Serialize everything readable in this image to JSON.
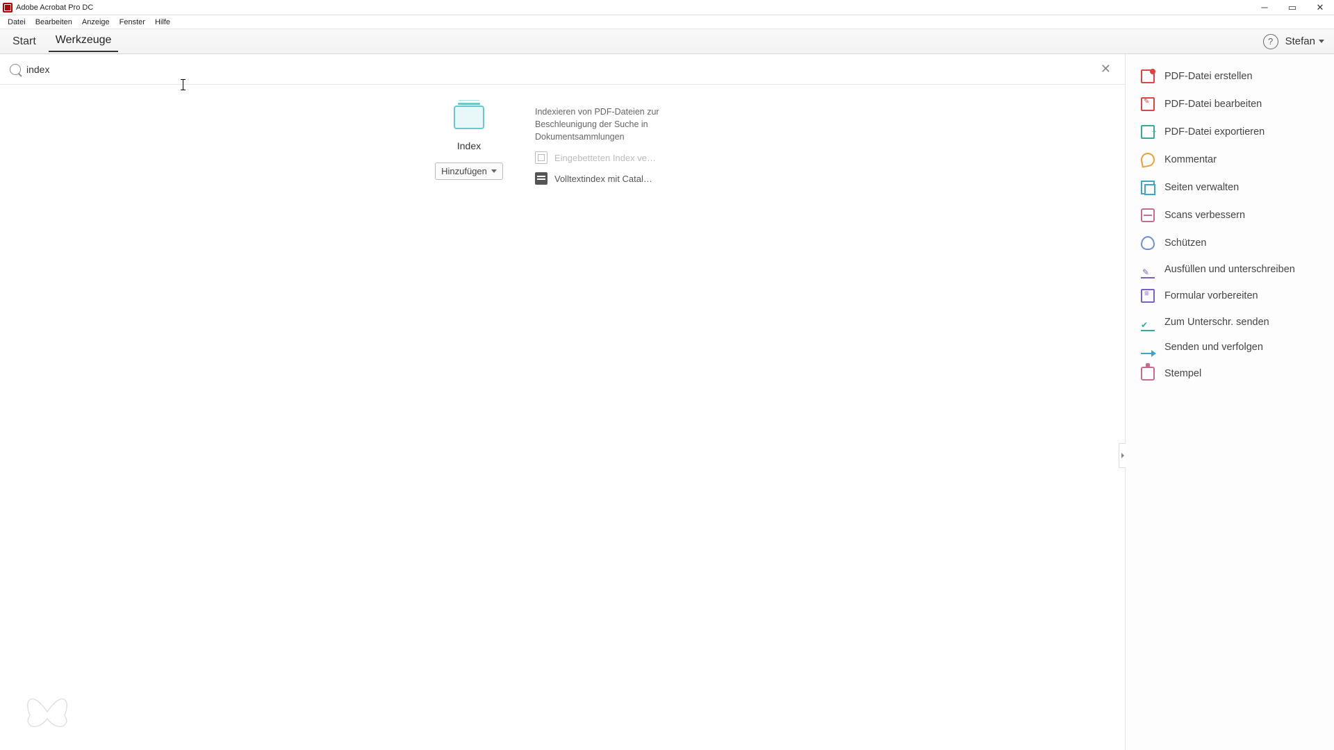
{
  "window": {
    "title": "Adobe Acrobat Pro DC"
  },
  "menu": [
    "Datei",
    "Bearbeiten",
    "Anzeige",
    "Fenster",
    "Hilfe"
  ],
  "tabs": {
    "start": "Start",
    "tools": "Werkzeuge"
  },
  "user": {
    "name": "Stefan"
  },
  "search": {
    "value": "index"
  },
  "result": {
    "name": "Index",
    "add_label": "Hinzufügen",
    "description": "Indexieren von PDF-Dateien zur Beschleunigung der Suche in Dokumentsammlungen",
    "sub_embedded": "Eingebetteten Index ve…",
    "sub_fulltext": "Volltextindex mit Catal…"
  },
  "sidebar": [
    "PDF-Datei erstellen",
    "PDF-Datei bearbeiten",
    "PDF-Datei exportieren",
    "Kommentar",
    "Seiten verwalten",
    "Scans verbessern",
    "Schützen",
    "Ausfüllen und unterschreiben",
    "Formular vorbereiten",
    "Zum Unterschr. senden",
    "Senden und verfolgen",
    "Stempel"
  ]
}
